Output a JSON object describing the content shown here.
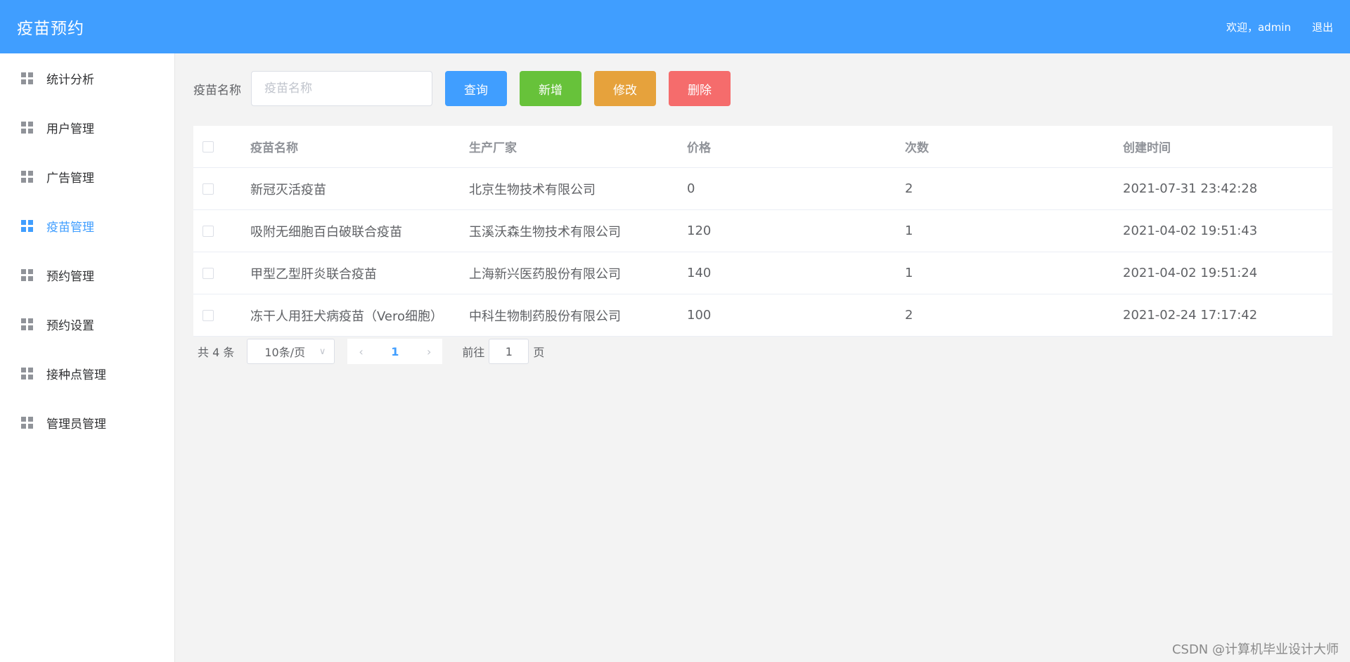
{
  "header": {
    "title": "疫苗预约",
    "welcome": "欢迎，admin",
    "logout": "退出"
  },
  "sidebar": {
    "items": [
      {
        "label": "统计分析",
        "active": false
      },
      {
        "label": "用户管理",
        "active": false
      },
      {
        "label": "广告管理",
        "active": false
      },
      {
        "label": "疫苗管理",
        "active": true
      },
      {
        "label": "预约管理",
        "active": false
      },
      {
        "label": "预约设置",
        "active": false
      },
      {
        "label": "接种点管理",
        "active": false
      },
      {
        "label": "管理员管理",
        "active": false
      }
    ]
  },
  "toolbar": {
    "search_label": "疫苗名称",
    "search_placeholder": "疫苗名称",
    "query": "查询",
    "add": "新增",
    "edit": "修改",
    "delete": "删除"
  },
  "table": {
    "headers": [
      "疫苗名称",
      "生产厂家",
      "价格",
      "次数",
      "创建时间"
    ],
    "rows": [
      [
        "新冠灭活疫苗",
        "北京生物技术有限公司",
        "0",
        "2",
        "2021-07-31 23:42:28"
      ],
      [
        "吸附无细胞百白破联合疫苗",
        "玉溪沃森生物技术有限公司",
        "120",
        "1",
        "2021-04-02 19:51:43"
      ],
      [
        "甲型乙型肝炎联合疫苗",
        "上海新兴医药股份有限公司",
        "140",
        "1",
        "2021-04-02 19:51:24"
      ],
      [
        "冻干人用狂犬病疫苗（Vero细胞）",
        "中科生物制药股份有限公司",
        "100",
        "2",
        "2021-02-24 17:17:42"
      ]
    ]
  },
  "pagination": {
    "total": "共 4 条",
    "page_size": "10条/页",
    "current_page": "1",
    "goto_prefix": "前往",
    "goto_value": "1",
    "goto_suffix": "页"
  },
  "watermark": "CSDN @计算机毕业设计大师",
  "colors": {
    "primary": "#409eff",
    "success": "#67c23a",
    "warning": "#e6a23c",
    "danger": "#f56c6c"
  }
}
